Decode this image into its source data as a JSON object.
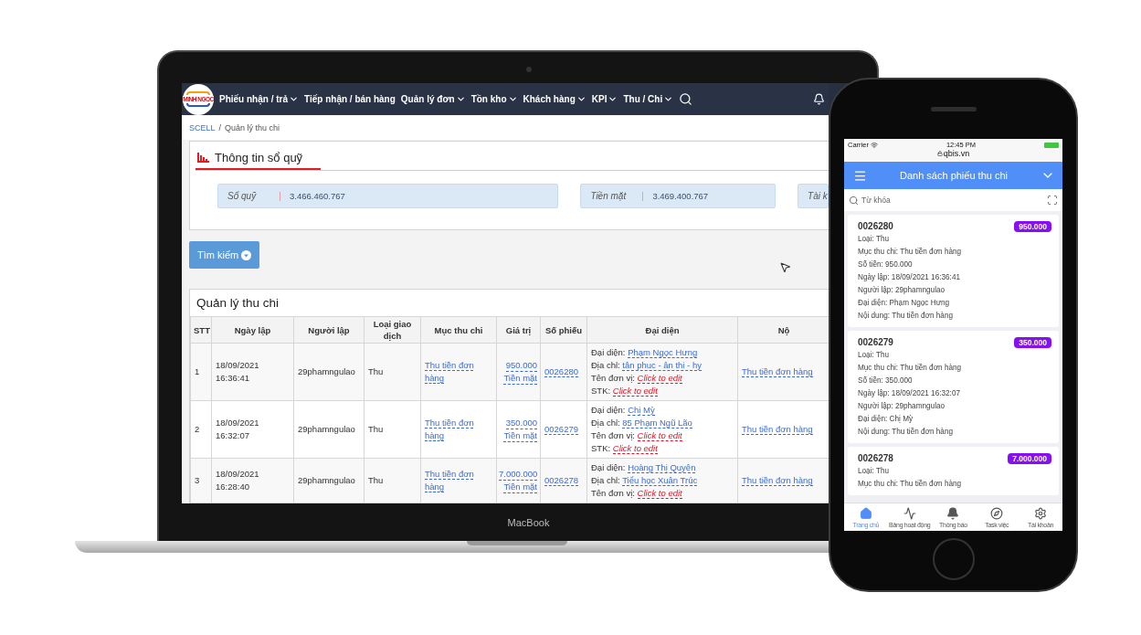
{
  "laptop": {
    "brand": "MacBook",
    "navbar": {
      "logo_text": "MINH NGOC",
      "items": [
        {
          "label": "Phiếu nhận / trả",
          "dropdown": true
        },
        {
          "label": "Tiếp nhận / bán hàng",
          "dropdown": false
        },
        {
          "label": "Quản lý đơn",
          "dropdown": true
        },
        {
          "label": "Tồn kho",
          "dropdown": true
        },
        {
          "label": "Khách hàng",
          "dropdown": true
        },
        {
          "label": "KPI",
          "dropdown": true
        },
        {
          "label": "Thu / Chi",
          "dropdown": true
        }
      ]
    },
    "breadcrumb": [
      {
        "label": "SCELL",
        "kind": "link"
      },
      {
        "label": "/",
        "kind": "separator"
      },
      {
        "label": "Quản lý thu chi",
        "kind": "current"
      }
    ],
    "fund_panel": {
      "title": "Thông tin sổ quỹ",
      "stats": [
        {
          "label": "Sổ quỹ",
          "value": "3.466.460.767"
        },
        {
          "label": "Tiền mặt",
          "value": "3.469.400.767"
        },
        {
          "label": "Tài k"
        }
      ]
    },
    "search_button": "Tìm kiếm",
    "table": {
      "title": "Quản lý thu chi",
      "columns": [
        "STT",
        "Ngày lập",
        "Người lập",
        "Loại giao dịch",
        "Mục thu chi",
        "Giá trị",
        "Số phiếu",
        "Đại diện",
        "Nộ"
      ],
      "rows": [
        {
          "stt": "1",
          "date": "18/09/2021",
          "time": "16:36:41",
          "creator": "29phamngulao",
          "type": "Thu",
          "category": "Thu tiền đơn hàng",
          "amount": "950.000",
          "method": "Tiền mặt",
          "receipt": "0026280",
          "rep": [
            {
              "label": "Đại diện:",
              "value": "Phạm Ngọc Hưng",
              "kind": "link"
            },
            {
              "label": "Địa chỉ:",
              "value": "tân phuc - ân thi - hy",
              "kind": "link"
            },
            {
              "label": "Tên đơn vị:",
              "value": "Click to edit",
              "kind": "edit"
            },
            {
              "label": "STK:",
              "value": "Click to edit",
              "kind": "edit"
            }
          ],
          "content": "Thu tiền đơn hàng"
        },
        {
          "stt": "2",
          "date": "18/09/2021",
          "time": "16:32:07",
          "creator": "29phamngulao",
          "type": "Thu",
          "category": "Thu tiền đơn hàng",
          "amount": "350.000",
          "method": "Tiền mặt",
          "receipt": "0026279",
          "rep": [
            {
              "label": "Đại diện:",
              "value": "Chị Mỳ",
              "kind": "link"
            },
            {
              "label": "Địa chỉ:",
              "value": "85 Phạm Ngũ Lão",
              "kind": "link"
            },
            {
              "label": "Tên đơn vị:",
              "value": "Click to edit",
              "kind": "edit"
            },
            {
              "label": "STK:",
              "value": "Click to edit",
              "kind": "edit"
            }
          ],
          "content": "Thu tiền đơn hàng"
        },
        {
          "stt": "3",
          "date": "18/09/2021",
          "time": "16:28:40",
          "creator": "29phamngulao",
          "type": "Thu",
          "category": "Thu tiền đơn hàng",
          "amount": "7.000.000",
          "method": "Tiền mặt",
          "receipt": "0026278",
          "rep": [
            {
              "label": "Đại diện:",
              "value": "Hoàng Thị Quyên",
              "kind": "link"
            },
            {
              "label": "Địa chỉ:",
              "value": "Tiểu học Xuân Trúc",
              "kind": "link"
            },
            {
              "label": "Tên đơn vị:",
              "value": "Click to edit",
              "kind": "edit"
            }
          ],
          "content": "Thu tiền đơn hàng"
        }
      ]
    }
  },
  "phone": {
    "status": {
      "carrier": "Carrier",
      "time": "12:45 PM",
      "url": "qbis.vn"
    },
    "header": {
      "title": "Danh sách phiếu thu chi"
    },
    "search": {
      "placeholder": "Từ khóa"
    },
    "cards": [
      {
        "id": "0026280",
        "badge": "950.000",
        "lines": [
          "Loại: Thu",
          "Mục thu chi: Thu tiền đơn hàng",
          "Số tiền: 950.000",
          "Ngày lập: 18/09/2021 16:36:41",
          "Người lập: 29phamngulao",
          "Đại diện: Phạm Ngọc Hưng",
          "Nội dung: Thu tiền đơn hàng"
        ]
      },
      {
        "id": "0026279",
        "badge": "350.000",
        "lines": [
          "Loại: Thu",
          "Mục thu chi: Thu tiền đơn hàng",
          "Số tiền: 350.000",
          "Ngày lập: 18/09/2021 16:32:07",
          "Người lập: 29phamngulao",
          "Đại diện: Chị Mỳ",
          "Nội dung: Thu tiền đơn hàng"
        ]
      },
      {
        "id": "0026278",
        "badge": "7.000.000",
        "lines": [
          "Loại: Thu",
          "Mục thu chi: Thu tiền đơn hàng"
        ]
      }
    ],
    "tabbar": [
      {
        "label": "Trang chủ",
        "selected": true
      },
      {
        "label": "Bảng hoạt động",
        "selected": false
      },
      {
        "label": "Thông báo",
        "selected": false
      },
      {
        "label": "Task việc",
        "selected": false
      },
      {
        "label": "Tài khoản",
        "selected": false
      }
    ]
  }
}
